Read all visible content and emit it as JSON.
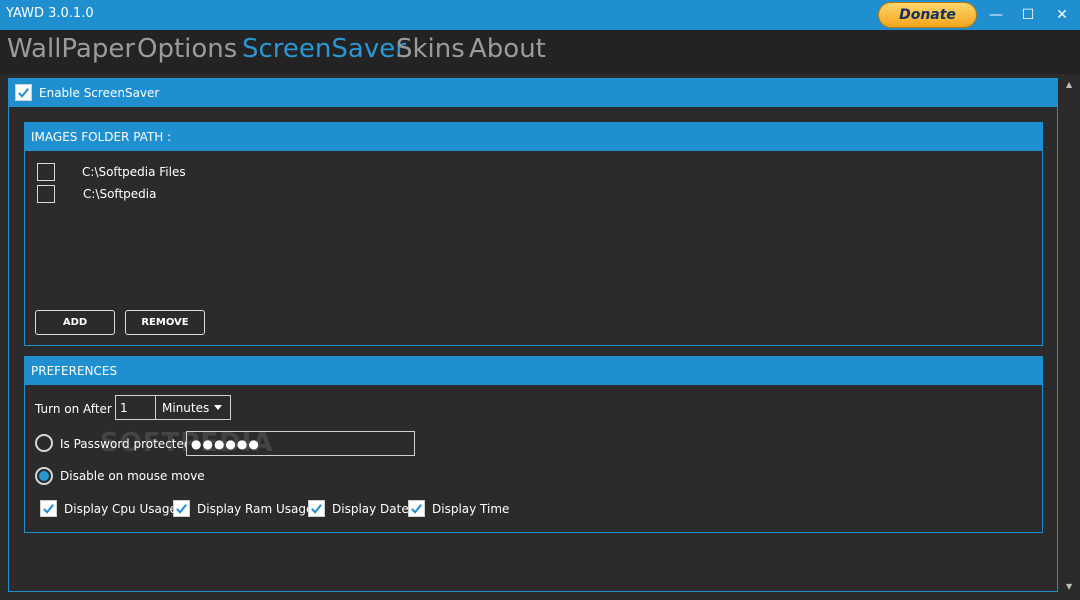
{
  "window": {
    "title": "YAWD 3.0.1.0",
    "donate_label": "Donate",
    "minimize": "—",
    "maximize": "☐",
    "close": "✕"
  },
  "nav": {
    "tabs": [
      "WallPaper",
      "Options",
      "ScreenSaver",
      "Skins",
      "About"
    ],
    "active": "ScreenSaver"
  },
  "screensaver": {
    "enable_label": "Enable ScreenSaver",
    "enabled": true
  },
  "images_folder": {
    "header": "IMAGES FOLDER PATH :",
    "folders": [
      {
        "path": "C:\\Softpedia Files",
        "checked": false
      },
      {
        "path": "C:\\Softpedia",
        "checked": false
      }
    ],
    "add_label": "ADD",
    "remove_label": "REMOVE"
  },
  "preferences": {
    "header": "PREFERENCES",
    "turn_on_label": "Turn on After :",
    "turn_on_value": "1",
    "unit_selected": "Minutes",
    "password_label": "Is Password protected :",
    "password_value": "●●●●●●",
    "password_selected": false,
    "mouse_move_label": "Disable on mouse move",
    "mouse_move_selected": true,
    "display_options": [
      {
        "label": "Display Cpu Usage",
        "checked": true
      },
      {
        "label": "Display Ram Usage",
        "checked": true
      },
      {
        "label": "Display Date",
        "checked": true
      },
      {
        "label": "Display Time",
        "checked": true
      }
    ]
  },
  "watermark": "SOFTPEDIA",
  "colors": {
    "accent": "#1f8fd0",
    "background": "#2b2b2b",
    "tab_active": "#2a96d4",
    "tab_inactive": "#9b9b9b"
  }
}
